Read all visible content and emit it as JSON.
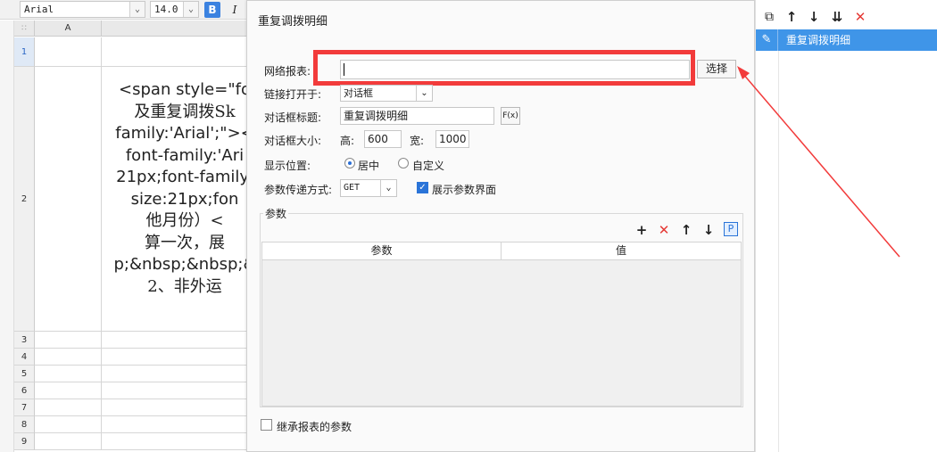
{
  "toolbar": {
    "font_name": "Arial",
    "font_size": "14.0"
  },
  "sheet": {
    "column_a": "A",
    "rows": [
      "1",
      "2",
      "3",
      "4",
      "5",
      "6",
      "7",
      "8",
      "9"
    ],
    "cell_lines": [
      "<span style=\"fo",
      "及重复调拨Sk",
      "family:'Arial';\"><",
      "font-family:'Ari",
      "21px;font-family:",
      "size:21px;fon",
      "他月份）<",
      "算一次，展",
      "p;&nbsp;&nbsp;&",
      "2、非外运"
    ]
  },
  "dialog": {
    "title": "重复调拨明细",
    "net_report_label": "网络报表:",
    "net_report_value": "",
    "select_button": "选择",
    "open_in_label": "链接打开于:",
    "open_in_value": "对话框",
    "dialog_title_label": "对话框标题:",
    "dialog_title_value": "重复调拨明细",
    "fx_label": "F(x)",
    "size_label": "对话框大小:",
    "height_label": "高:",
    "height_value": "600",
    "width_label": "宽:",
    "width_value": "1000",
    "position_label": "显示位置:",
    "position_center": "居中",
    "position_custom": "自定义",
    "param_pass_label": "参数传递方式:",
    "param_pass_value": "GET",
    "show_params_label": "展示参数界面",
    "params_group_label": "参数",
    "table_col_param": "参数",
    "table_col_value": "值",
    "inherit_label": "继承报表的参数"
  },
  "right_panel": {
    "items": [
      {
        "label": "重复调拨明细"
      }
    ]
  }
}
